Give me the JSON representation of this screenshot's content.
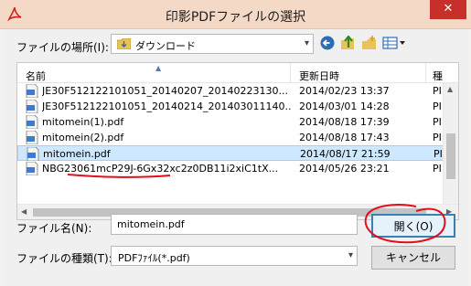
{
  "window": {
    "title": "印影PDFファイルの選択",
    "close_symbol": "✕"
  },
  "location": {
    "label": "ファイルの場所(I):",
    "value": "ダウンロード"
  },
  "toolbar": {
    "icons": [
      "back-icon",
      "up-folder-icon",
      "new-folder-icon",
      "view-menu-icon"
    ]
  },
  "file_list": {
    "columns": [
      "名前",
      "更新日時",
      "種"
    ],
    "rows": [
      {
        "name": "JE30F512122101051_20140207_20140223130...",
        "date": "2014/02/23 13:37",
        "type": "PI",
        "selected": false
      },
      {
        "name": "JE30F512122101051_20140214_201403011140...",
        "date": "2014/03/01 14:28",
        "type": "PI",
        "selected": false
      },
      {
        "name": "mitomein(1).pdf",
        "date": "2014/08/18 17:39",
        "type": "PI",
        "selected": false
      },
      {
        "name": "mitomein(2).pdf",
        "date": "2014/08/18 17:43",
        "type": "PI",
        "selected": false
      },
      {
        "name": "mitomein.pdf",
        "date": "2014/08/17 21:59",
        "type": "PI",
        "selected": true
      },
      {
        "name": "NBG23061mcP29J-6Gx32xc2z0DB11i2xiC1tX...",
        "date": "2014/05/26 23:21",
        "type": "PI",
        "selected": false
      }
    ]
  },
  "filename": {
    "label": "ファイル名(N):",
    "value": "mitomein.pdf"
  },
  "filetype": {
    "label": "ファイルの種類(T):",
    "value": "PDFﾌｧｲﾙ(*.pdf)"
  },
  "buttons": {
    "open": "開く(O)",
    "cancel": "キャンセル"
  },
  "colors": {
    "titlebar": "#f4d9c6",
    "selection": "#cde8ff",
    "annotation": "#e0101a",
    "close": "#c7302a"
  }
}
